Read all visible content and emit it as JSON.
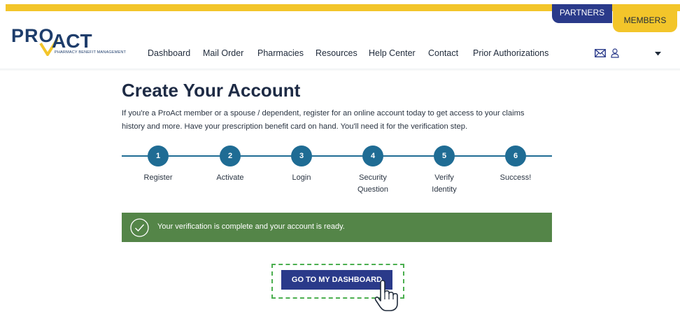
{
  "header": {
    "tabs": {
      "partners": "PARTNERS",
      "members": "MEMBERS"
    },
    "logo": {
      "pro": "PRO",
      "act": "ACT",
      "tagline": "PHARMACY BENEFIT MANAGEMENT"
    },
    "nav": [
      "Dashboard",
      "Mail Order",
      "Pharmacies",
      "Resources",
      "Help Center",
      "Contact",
      "Prior Authorizations"
    ],
    "icons": [
      "mail-icon",
      "user-icon",
      "caret-down-icon"
    ]
  },
  "main": {
    "title": "Create Your Account",
    "intro": "If you're a ProAct member or a spouse / dependent, register for an online account today to get access to your claims history and more. Have your prescription benefit card on hand. You'll need it for the verification step.",
    "steps": [
      {
        "number": "1",
        "label": "Register"
      },
      {
        "number": "2",
        "label": "Activate"
      },
      {
        "number": "3",
        "label": "Login"
      },
      {
        "number": "4",
        "label": "Security Question"
      },
      {
        "number": "5",
        "label": "Verify Identity"
      },
      {
        "number": "6",
        "label": "Success!"
      }
    ],
    "alert": "Your verification is complete and your account is ready.",
    "dashboard_button": "GO TO MY DASHBOARD"
  },
  "colors": {
    "brand_navy": "#2a3a8a",
    "brand_yellow": "#f3c52a",
    "step_blue": "#1f6c94",
    "success_green": "#548548",
    "highlight_green": "#4caf50"
  }
}
